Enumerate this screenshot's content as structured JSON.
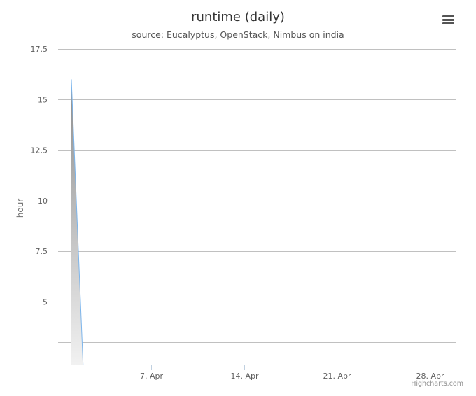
{
  "chart_data": {
    "type": "area",
    "title": "runtime (daily)",
    "subtitle": "source: Eucalyptus, OpenStack, Nimbus on india",
    "ylabel": "hour",
    "xlabel": "",
    "ylim": [
      1.9,
      17.5
    ],
    "xlim": [
      "2014-03-31",
      "2014-04-30"
    ],
    "yticks": [
      {
        "value": 5,
        "label": "5"
      },
      {
        "value": 7.5,
        "label": "7.5"
      },
      {
        "value": 10,
        "label": "10"
      },
      {
        "value": 12.5,
        "label": "12.5"
      },
      {
        "value": 15,
        "label": "15"
      },
      {
        "value": 17.5,
        "label": "17.5"
      }
    ],
    "ygridlines": [
      3,
      5,
      7.5,
      10,
      12.5,
      15,
      17.5
    ],
    "xticks": [
      {
        "value": "2014-04-07",
        "label": "7. Apr"
      },
      {
        "value": "2014-04-14",
        "label": "14. Apr"
      },
      {
        "value": "2014-04-21",
        "label": "21. Apr"
      },
      {
        "value": "2014-04-28",
        "label": "28. Apr"
      }
    ],
    "series": [
      {
        "x": [
          "2014-04-01",
          "2014-04-02"
        ],
        "y": [
          16,
          0
        ]
      }
    ],
    "grid": true,
    "legend": "none",
    "colors": {
      "line": "#7cb5ec",
      "fill_top": "#8c8c8c",
      "fill_bottom": "#ffffff",
      "grid": "#c0c0c0",
      "axis": "#c0d0e0"
    }
  },
  "menu": {
    "icon": "menu-icon"
  },
  "credits": "Highcharts.com"
}
